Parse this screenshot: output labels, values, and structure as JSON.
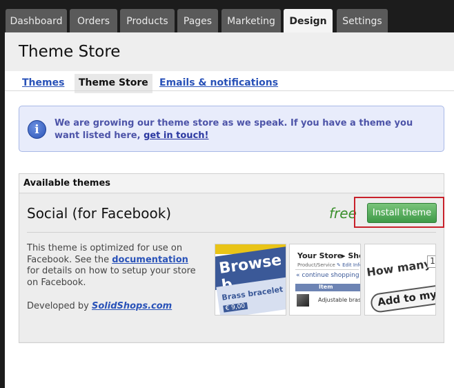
{
  "nav": {
    "tabs": [
      {
        "label": "Dashboard"
      },
      {
        "label": "Orders"
      },
      {
        "label": "Products"
      },
      {
        "label": "Pages"
      },
      {
        "label": "Marketing"
      },
      {
        "label": "Design",
        "active": true
      },
      {
        "label": "Settings"
      }
    ]
  },
  "header": {
    "title": "Theme Store"
  },
  "subtabs": [
    {
      "label": "Themes"
    },
    {
      "label": "Theme Store",
      "active": true
    },
    {
      "label": "Emails & notifications"
    }
  ],
  "info": {
    "text": "We are growing our theme store as we speak. If you have a theme you want listed here,",
    "link": "get in touch!",
    "icon": "info-icon"
  },
  "themes_panel": {
    "title": "Available themes",
    "theme": {
      "name": "Social (for Facebook)",
      "price": "free",
      "install_label": "Install theme",
      "description_pre": "This theme is optimized for use on Facebook. See the",
      "description_link": "documentation",
      "description_post": "for details on how to setup your store on Facebook.",
      "developer_prefix": "Developed by",
      "developer_link": "SolidShops.com",
      "thumbnails": [
        {
          "big": "Browse b",
          "item": "Brass bracelet",
          "price": "€ 9,00"
        },
        {
          "title": "Your Store",
          "crumb": "▸ Sho",
          "sub": "Product/Service",
          "edit": "✎ Edit Info",
          "back": "« continue shopping",
          "col": "Item",
          "item": "Adjustable brass"
        },
        {
          "q": "How many?",
          "qty": "1",
          "btn": "Add to my c"
        }
      ]
    }
  },
  "colors": {
    "accent_link": "#2952b8",
    "install_green": "#4ea656",
    "price_green": "#3a8f2c",
    "highlight_red": "#c8202a"
  }
}
